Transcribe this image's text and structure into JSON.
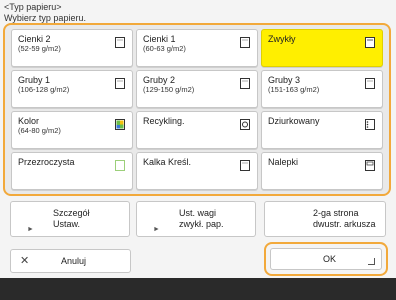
{
  "header": {
    "title": "<Typ papieru>",
    "subtitle": "Wybierz typ papieru."
  },
  "paper_types": [
    {
      "name": "Cienki 2",
      "sub": "(52-59 g/m2)",
      "selected": false,
      "icon": "paper-sheet-icon"
    },
    {
      "name": "Cienki 1",
      "sub": "(60-63 g/m2)",
      "selected": false,
      "icon": "paper-sheet-icon"
    },
    {
      "name": "Zwykły",
      "sub": "",
      "selected": true,
      "icon": "paper-sheet-icon"
    },
    {
      "name": "Gruby 1",
      "sub": "(106-128 g/m2)",
      "selected": false,
      "icon": "paper-sheet-icon"
    },
    {
      "name": "Gruby 2",
      "sub": "(129-150 g/m2)",
      "selected": false,
      "icon": "paper-sheet-icon"
    },
    {
      "name": "Gruby 3",
      "sub": "(151-163 g/m2)",
      "selected": false,
      "icon": "paper-sheet-icon"
    },
    {
      "name": "Kolor",
      "sub": "(64-80 g/m2)",
      "selected": false,
      "icon": "color-paper-icon"
    },
    {
      "name": "Recykling.",
      "sub": "",
      "selected": false,
      "icon": "recycled-paper-icon"
    },
    {
      "name": "Dziurkowany",
      "sub": "",
      "selected": false,
      "icon": "punched-paper-icon"
    },
    {
      "name": "Przezroczysta",
      "sub": "",
      "selected": false,
      "icon": "transparency-icon"
    },
    {
      "name": "Kalka Kreśl.",
      "sub": "",
      "selected": false,
      "icon": "tracing-paper-icon"
    },
    {
      "name": "Nalepki",
      "sub": "",
      "selected": false,
      "icon": "labels-icon"
    }
  ],
  "bottom_buttons": {
    "details": "Szczegół\nUstaw.",
    "weight": "Ust. wagi\nzwykł. pap.",
    "second_side": "2-ga strona\ndwustr. arkusza"
  },
  "actions": {
    "cancel": "Anuluj",
    "ok": "OK"
  },
  "colors": {
    "highlight_border": "#f2a93b",
    "selected_fill": "#ffef00",
    "footer_bar": "#2a2a2a"
  }
}
